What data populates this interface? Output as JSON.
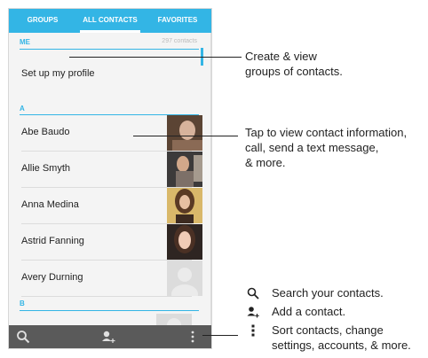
{
  "tabs": [
    "GROUPS",
    "ALL CONTACTS",
    "FAVORITES"
  ],
  "list": {
    "me_header": "ME",
    "contact_count": "297 contacts",
    "profile_label": "Set up my profile",
    "section_a": "A",
    "section_b": "B",
    "contacts": [
      {
        "name": "Abe Baudo",
        "photo": "photo"
      },
      {
        "name": "Allie Smyth",
        "photo": "photo"
      },
      {
        "name": "Anna Medina",
        "photo": "photo"
      },
      {
        "name": "Astrid Fanning",
        "photo": "photo"
      },
      {
        "name": "Avery Durning",
        "photo": "placeholder"
      }
    ]
  },
  "callouts": {
    "groups": [
      "Create & view",
      "groups of contacts."
    ],
    "contact": [
      "Tap to view contact information,",
      "call, send a text message,",
      "& more."
    ]
  },
  "legend": {
    "search": "Search your contacts.",
    "add": "Add a contact.",
    "menu": [
      "Sort contacts, change",
      "settings, accounts, & more."
    ]
  },
  "icons": {
    "search": "search-icon",
    "add_contact": "add-contact-icon",
    "menu": "overflow-menu-icon"
  },
  "colors": {
    "accent": "#33b5e5",
    "bottom_bar": "#5a5a5a"
  }
}
